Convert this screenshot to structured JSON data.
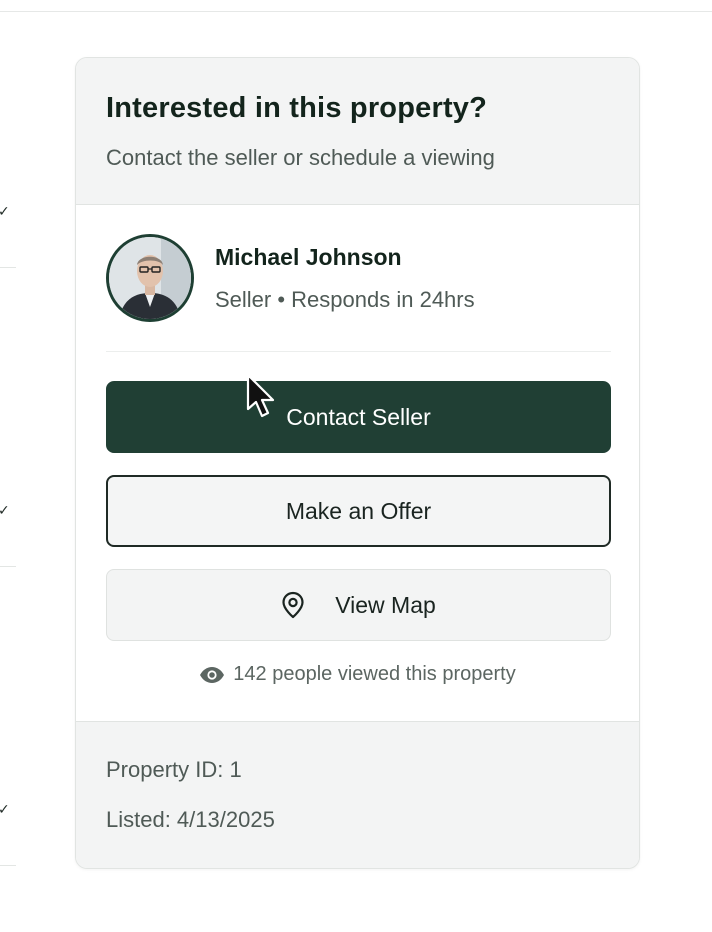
{
  "card": {
    "title": "Interested in this property?",
    "subtitle": "Contact the seller or schedule a viewing"
  },
  "seller": {
    "name": "Michael Johnson",
    "role_meta": "Seller • Responds in 24hrs",
    "avatar_icon": "person-portrait"
  },
  "actions": {
    "contact_label": "Contact Seller",
    "offer_label": "Make an Offer",
    "map_label": "View Map",
    "map_icon": "location-pin-icon"
  },
  "views": {
    "text": "142 people viewed this property",
    "icon": "eye-icon"
  },
  "footer": {
    "property_id": "Property ID: 1",
    "listed": "Listed: 4/13/2025"
  },
  "colors": {
    "primary": "#203f34",
    "title": "#13241c",
    "muted": "#4f5a56",
    "panel": "#f3f4f4"
  }
}
